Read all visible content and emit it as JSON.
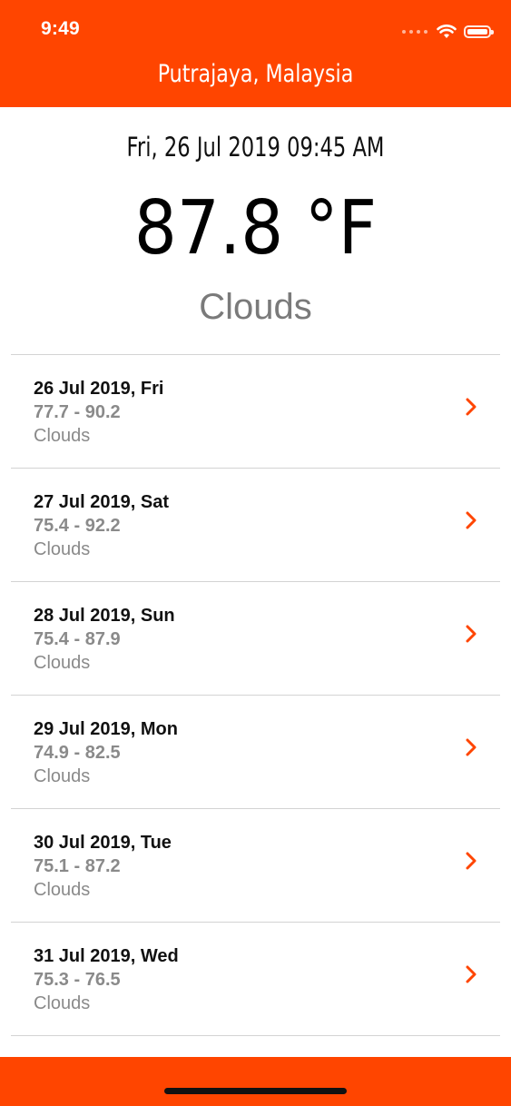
{
  "status_bar": {
    "time": "9:49"
  },
  "header": {
    "title": "Putrajaya, Malaysia"
  },
  "current": {
    "datetime": "Fri, 26 Jul 2019 09:45 AM",
    "temperature": "87.8 °F",
    "condition": "Clouds"
  },
  "forecast": [
    {
      "date": "26 Jul 2019, Fri",
      "range": "77.7 - 90.2",
      "condition": "Clouds"
    },
    {
      "date": "27 Jul 2019, Sat",
      "range": "75.4 - 92.2",
      "condition": "Clouds"
    },
    {
      "date": "28 Jul 2019, Sun",
      "range": "75.4 - 87.9",
      "condition": "Clouds"
    },
    {
      "date": "29 Jul 2019, Mon",
      "range": "74.9 - 82.5",
      "condition": "Clouds"
    },
    {
      "date": "30 Jul 2019, Tue",
      "range": "75.1 - 87.2",
      "condition": "Clouds"
    },
    {
      "date": "31 Jul 2019, Wed",
      "range": "75.3 - 76.5",
      "condition": "Clouds"
    }
  ],
  "colors": {
    "accent": "#ff4500",
    "secondary_text": "#8a8a8a",
    "divider": "#d3d3d3"
  },
  "icons": {
    "row_disclosure": "chevron-right-icon",
    "wifi": "wifi-icon",
    "battery": "battery-icon",
    "signal": "cellular-signal-icon"
  }
}
